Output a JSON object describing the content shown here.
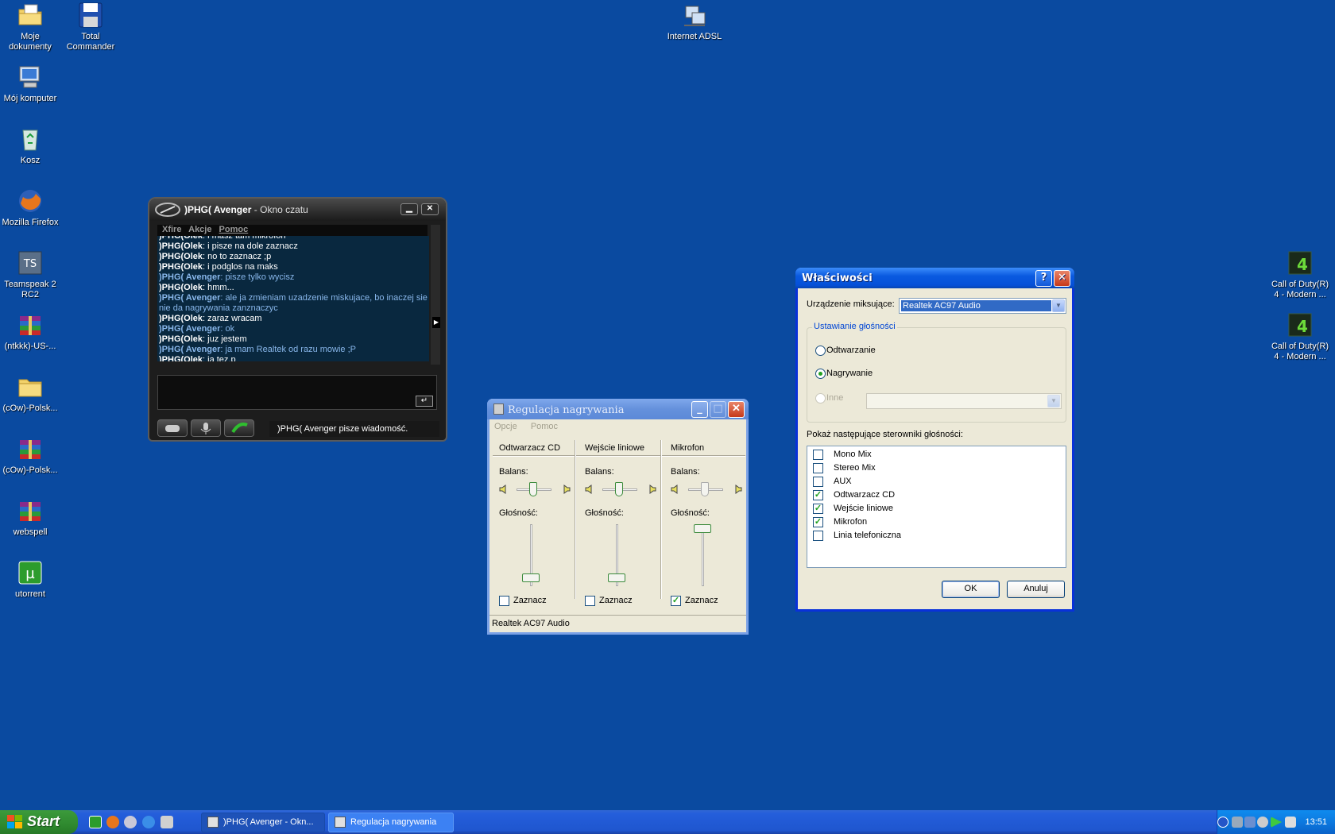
{
  "desktop": {
    "icons_left": [
      {
        "label": "Moje dokumenty",
        "icon": "folder-documents-icon"
      },
      {
        "label": "Total Commander",
        "icon": "floppy-disk-icon"
      },
      {
        "label": "Mój komputer",
        "icon": "computer-icon"
      },
      {
        "label": "Kosz",
        "icon": "recycle-bin-icon"
      },
      {
        "label": "Mozilla Firefox",
        "icon": "firefox-icon"
      },
      {
        "label": "Teamspeak 2 RC2",
        "icon": "teamspeak-icon"
      },
      {
        "label": "(ntkkk)-US-...",
        "icon": "rar-archive-icon"
      },
      {
        "label": "(cOw)-Polsk...",
        "icon": "folder-icon"
      },
      {
        "label": "(cOw)-Polsk...",
        "icon": "rar-archive-icon"
      },
      {
        "label": "webspell",
        "icon": "rar-archive-icon"
      },
      {
        "label": "utorrent",
        "icon": "utorrent-icon"
      }
    ],
    "internet": {
      "label": "Internet ADSL",
      "icon": "network-connection-icon"
    },
    "icons_right": [
      {
        "label": "Call of Duty(R) 4 - Modern ...",
        "icon": "cod4-icon"
      },
      {
        "label": "Call of Duty(R) 4 - Modern ...",
        "icon": "cod4-icon"
      }
    ]
  },
  "xfire": {
    "title_nick": ")PHG( Avenger",
    "title_sub": " - Okno czatu",
    "menu": [
      "Xfire",
      "Akcje",
      "Pomoc"
    ],
    "messages": [
      {
        "nick": ")PHG(Olek",
        "text": ": i masz tam mikrofon",
        "self": false
      },
      {
        "nick": ")PHG(Olek",
        "text": ": i pisze na dole zaznacz",
        "self": false
      },
      {
        "nick": ")PHG(Olek",
        "text": ": no to zaznacz ;p",
        "self": false
      },
      {
        "nick": ")PHG(Olek",
        "text": ": i podglos na maks",
        "self": false
      },
      {
        "nick": ")PHG( Avenger",
        "text": ": pisze tylko wycisz",
        "self": true
      },
      {
        "nick": ")PHG(Olek",
        "text": ": hmm...",
        "self": false
      },
      {
        "nick": ")PHG( Avenger",
        "text": ": ale ja zmieniam uzadzenie miskujace, bo inaczej sie nie da nagrywania zanznaczyc",
        "self": true
      },
      {
        "nick": ")PHG(Olek",
        "text": ": zaraz wracam",
        "self": false
      },
      {
        "nick": ")PHG( Avenger",
        "text": ": ok",
        "self": true
      },
      {
        "nick": ")PHG(Olek",
        "text": ": juz jestem",
        "self": false
      },
      {
        "nick": ")PHG( Avenger",
        "text": ": ja mam Realtek od razu mowie ;P",
        "self": true
      },
      {
        "nick": ")PHG(Olek",
        "text": ": ja tez.p",
        "self": false
      }
    ],
    "status": ")PHG( Avenger pisze wiadomość."
  },
  "recording": {
    "title": "Regulacja nagrywania",
    "menu": [
      "Opcje",
      "Pomoc"
    ],
    "columns": [
      {
        "name": "Odtwarzacz CD",
        "balance_label": "Balans:",
        "volume_label": "Głośność:",
        "volume": 0,
        "select_label": "Zaznacz",
        "selected": false
      },
      {
        "name": "Wejście liniowe",
        "balance_label": "Balans:",
        "volume_label": "Głośność:",
        "volume": 0,
        "select_label": "Zaznacz",
        "selected": false
      },
      {
        "name": "Mikrofon",
        "balance_label": "Balans:",
        "volume_label": "Głośność:",
        "volume": 1,
        "select_label": "Zaznacz",
        "selected": true
      }
    ],
    "status": "Realtek AC97 Audio"
  },
  "properties": {
    "title": "Właściwości",
    "help_glyph": "?",
    "mixer_label": "Urządzenie miksujące:",
    "mixer_value": "Realtek AC97 Audio",
    "group_title": "Ustawianie głośności",
    "radio_playback": "Odtwarzanie",
    "radio_recording": "Nagrywanie",
    "radio_other": "Inne",
    "list_label": "Pokaż następujące sterowniki głośności:",
    "controls": [
      {
        "label": "Mono Mix",
        "checked": false
      },
      {
        "label": "Stereo Mix",
        "checked": false
      },
      {
        "label": "AUX",
        "checked": false
      },
      {
        "label": "Odtwarzacz CD",
        "checked": true
      },
      {
        "label": "Wejście liniowe",
        "checked": true
      },
      {
        "label": "Mikrofon",
        "checked": true
      },
      {
        "label": "Linia telefoniczna",
        "checked": false
      }
    ],
    "ok": "OK",
    "cancel": "Anuluj"
  },
  "taskbar": {
    "start": "Start",
    "tasks": [
      ")PHG( Avenger - Okn...",
      "Regulacja nagrywania"
    ],
    "clock": "13:51"
  }
}
